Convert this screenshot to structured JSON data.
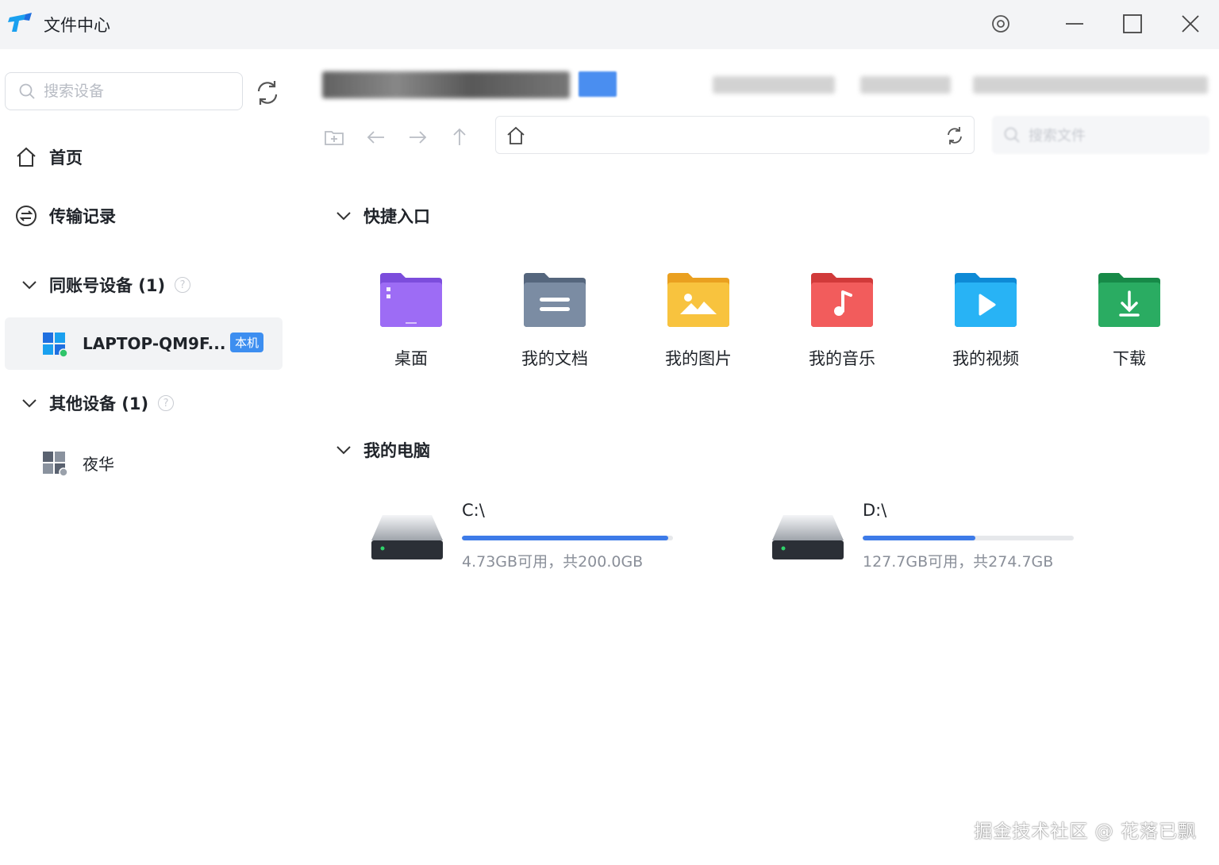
{
  "window": {
    "title": "文件中心",
    "settings_icon": "settings-ring-icon",
    "minimize_icon": "minimize-icon",
    "maximize_icon": "maximize-icon",
    "close_icon": "close-icon"
  },
  "sidebar": {
    "search_placeholder": "搜索设备",
    "nav": [
      {
        "label": "首页",
        "icon": "home-icon"
      },
      {
        "label": "传输记录",
        "icon": "transfer-icon"
      }
    ],
    "groups": [
      {
        "label": "同账号设备 (1)",
        "expanded": true,
        "devices": [
          {
            "name": "LAPTOP-QM9F...",
            "badge": "本机",
            "icon": "windows-icon",
            "status": "online",
            "selected": true
          }
        ]
      },
      {
        "label": "其他设备 (1)",
        "expanded": true,
        "devices": [
          {
            "name": "夜华",
            "icon": "windows-icon",
            "status": "offline",
            "selected": false
          }
        ]
      }
    ]
  },
  "main": {
    "search_placeholder": "搜索文件",
    "quick_access": {
      "label": "快捷入口",
      "items": [
        {
          "label": "桌面",
          "icon": "desktop-folder-icon",
          "color": "#8b5cf6"
        },
        {
          "label": "我的文档",
          "icon": "documents-folder-icon",
          "color": "#6b7f99"
        },
        {
          "label": "我的图片",
          "icon": "pictures-folder-icon",
          "color": "#f5b731"
        },
        {
          "label": "我的音乐",
          "icon": "music-folder-icon",
          "color": "#e94b4b"
        },
        {
          "label": "我的视频",
          "icon": "videos-folder-icon",
          "color": "#1aa3f0"
        },
        {
          "label": "下载",
          "icon": "downloads-folder-icon",
          "color": "#22a05a"
        }
      ]
    },
    "my_computer": {
      "label": "我的电脑",
      "drives": [
        {
          "name": "C:\\",
          "info": "4.73GB可用，共200.0GB",
          "used_fraction": 0.976
        },
        {
          "name": "D:\\",
          "info": "127.7GB可用，共274.7GB",
          "used_fraction": 0.535
        }
      ]
    }
  },
  "watermark": "掘金技术社区 @ 花落已飘",
  "colors": {
    "accent": "#3d7be8",
    "badge": "#3d8ef0"
  }
}
